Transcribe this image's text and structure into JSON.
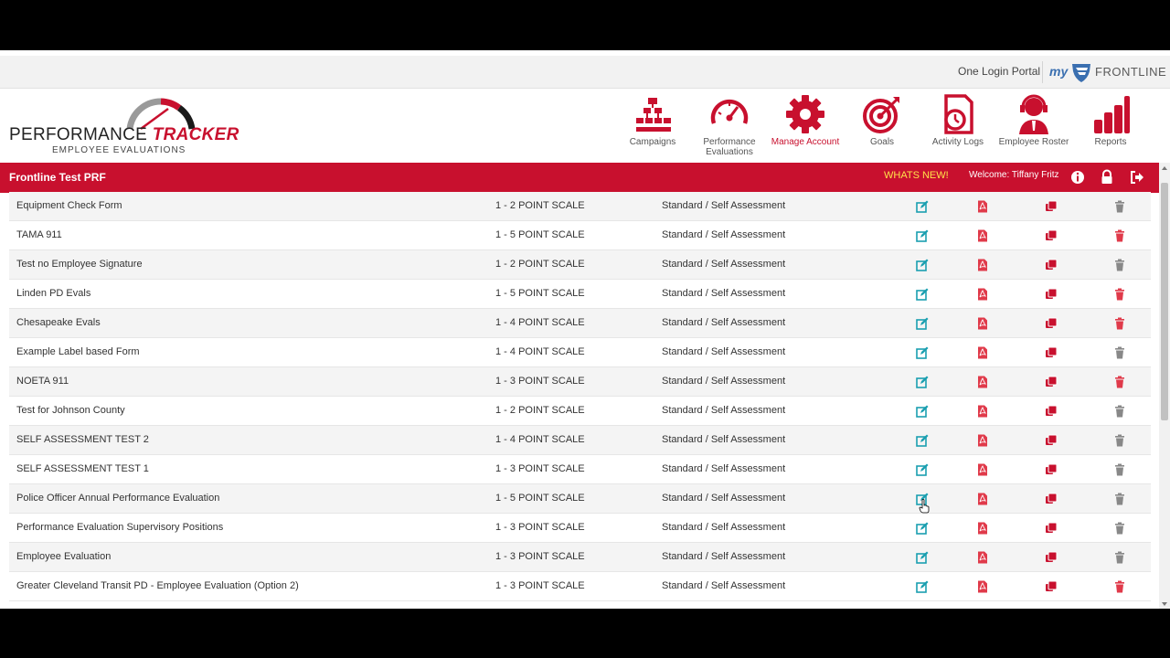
{
  "topbar": {
    "login_label": "One Login Portal",
    "brand_prefix": "my",
    "brand_name": "FRONTLINE"
  },
  "logo": {
    "title_part1": "PERFORMANCE",
    "title_part2": "TRACKER",
    "subtitle": "EMPLOYEE EVALUATIONS"
  },
  "nav": {
    "items": [
      {
        "label": "Campaigns",
        "icon": "org-chart-icon"
      },
      {
        "label": "Performance Evaluations",
        "icon": "speedometer-icon"
      },
      {
        "label": "Manage Account",
        "icon": "gear-icon",
        "active": true
      },
      {
        "label": "Goals",
        "icon": "target-icon"
      },
      {
        "label": "Activity Logs",
        "icon": "clock-document-icon"
      },
      {
        "label": "Employee Roster",
        "icon": "headset-person-icon"
      },
      {
        "label": "Reports",
        "icon": "bar-chart-icon"
      }
    ]
  },
  "redbar": {
    "title": "Frontline Test PRF",
    "whats_new": "WHATS NEW!",
    "welcome": "Welcome: Tiffany Fritz"
  },
  "colors": {
    "brand_red": "#c8102e",
    "edit_teal": "#1a9fb0",
    "delete_red": "#e03a4a",
    "delete_gray": "#888888",
    "whats_new_yellow": "#ffe24a"
  },
  "rows": [
    {
      "name": "Equipment Check Form",
      "scale": "1 - 2 POINT SCALE",
      "type": "Standard / Self Assessment",
      "delete_color": "gray"
    },
    {
      "name": "TAMA 911",
      "scale": "1 - 5 POINT SCALE",
      "type": "Standard / Self Assessment",
      "delete_color": "red"
    },
    {
      "name": "Test no Employee Signature",
      "scale": "1 - 2 POINT SCALE",
      "type": "Standard / Self Assessment",
      "delete_color": "gray"
    },
    {
      "name": "Linden PD Evals",
      "scale": "1 - 5 POINT SCALE",
      "type": "Standard / Self Assessment",
      "delete_color": "red"
    },
    {
      "name": "Chesapeake Evals",
      "scale": "1 - 4 POINT SCALE",
      "type": "Standard / Self Assessment",
      "delete_color": "red"
    },
    {
      "name": "Example Label based Form",
      "scale": "1 - 4 POINT SCALE",
      "type": "Standard / Self Assessment",
      "delete_color": "gray"
    },
    {
      "name": "NOETA 911",
      "scale": "1 - 3 POINT SCALE",
      "type": "Standard / Self Assessment",
      "delete_color": "red"
    },
    {
      "name": "Test for Johnson County",
      "scale": "1 - 2 POINT SCALE",
      "type": "Standard / Self Assessment",
      "delete_color": "gray"
    },
    {
      "name": "SELF ASSESSMENT TEST 2",
      "scale": "1 - 4 POINT SCALE",
      "type": "Standard / Self Assessment",
      "delete_color": "gray"
    },
    {
      "name": "SELF ASSESSMENT TEST 1",
      "scale": "1 - 3 POINT SCALE",
      "type": "Standard / Self Assessment",
      "delete_color": "gray"
    },
    {
      "name": "Police Officer Annual Performance Evaluation",
      "scale": "1 - 5 POINT SCALE",
      "type": "Standard / Self Assessment",
      "delete_color": "gray"
    },
    {
      "name": "Performance Evaluation Supervisory Positions",
      "scale": "1 - 3 POINT SCALE",
      "type": "Standard / Self Assessment",
      "delete_color": "gray"
    },
    {
      "name": "Employee Evaluation",
      "scale": "1 - 3 POINT SCALE",
      "type": "Standard / Self Assessment",
      "delete_color": "gray"
    },
    {
      "name": "Greater Cleveland Transit PD - Employee Evaluation (Option 2)",
      "scale": "1 - 3 POINT SCALE",
      "type": "Standard / Self Assessment",
      "delete_color": "red"
    }
  ]
}
